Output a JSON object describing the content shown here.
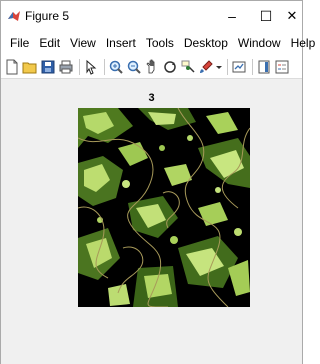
{
  "window": {
    "title": "Figure 5",
    "controls": {
      "minimize": "–",
      "maximize": "☐",
      "close": "✕"
    }
  },
  "menubar": {
    "items": [
      "File",
      "Edit",
      "View",
      "Insert",
      "Tools",
      "Desktop",
      "Window",
      "Help"
    ]
  },
  "toolbar": {
    "buttons": [
      "new-figure-icon",
      "open-file-icon",
      "save-icon",
      "print-icon",
      "pointer-icon",
      "zoom-in-icon",
      "zoom-out-icon",
      "pan-icon",
      "rotate-3d-icon",
      "data-cursor-icon",
      "brush-icon",
      "link-plot-icon",
      "colorbar-icon",
      "legend-icon"
    ]
  },
  "axes": {
    "title": "3"
  },
  "colors": {
    "accent": "#d8453c",
    "foliage_light": "#b5d96a",
    "foliage_dark": "#4f7a1f",
    "outline": "#a89a5a",
    "background": "#000000"
  }
}
